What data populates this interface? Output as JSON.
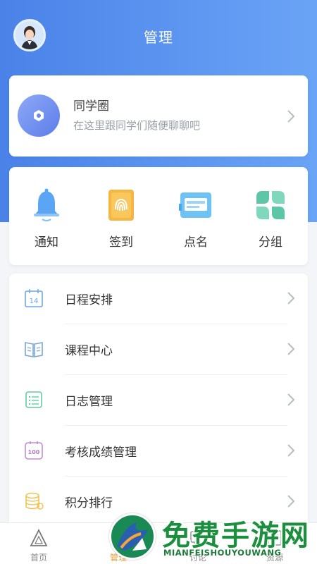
{
  "header": {
    "title": "管理"
  },
  "classmate": {
    "title": "同学圈",
    "subtitle": "在这里跟同学们随便聊聊吧"
  },
  "quick_actions": [
    {
      "label": "通知",
      "icon": "bell-icon"
    },
    {
      "label": "签到",
      "icon": "fingerprint-icon"
    },
    {
      "label": "点名",
      "icon": "card-reader-icon"
    },
    {
      "label": "分组",
      "icon": "clover-icon"
    }
  ],
  "menu": [
    {
      "label": "日程安排",
      "icon": "calendar-icon",
      "icon_text": "14"
    },
    {
      "label": "课程中心",
      "icon": "book-icon"
    },
    {
      "label": "日志管理",
      "icon": "log-list-icon"
    },
    {
      "label": "考核成绩管理",
      "icon": "score-icon",
      "icon_text": "100"
    },
    {
      "label": "积分排行",
      "icon": "coins-icon"
    }
  ],
  "tabs": [
    {
      "label": "首页",
      "icon": "home-triangle-icon"
    },
    {
      "label": "管理",
      "icon": "manage-icon",
      "active": true
    },
    {
      "label": "讨论",
      "icon": "discuss-icon"
    },
    {
      "label": "资源",
      "icon": "resource-icon"
    }
  ],
  "watermark": {
    "title": "免费手游网",
    "subtitle": "MIANFEISHOUYOUWANG"
  },
  "colors": {
    "header_gradient_start": "#4a82e8",
    "header_gradient_end": "#6aa4f6",
    "active_tab": "#e8a23a"
  }
}
